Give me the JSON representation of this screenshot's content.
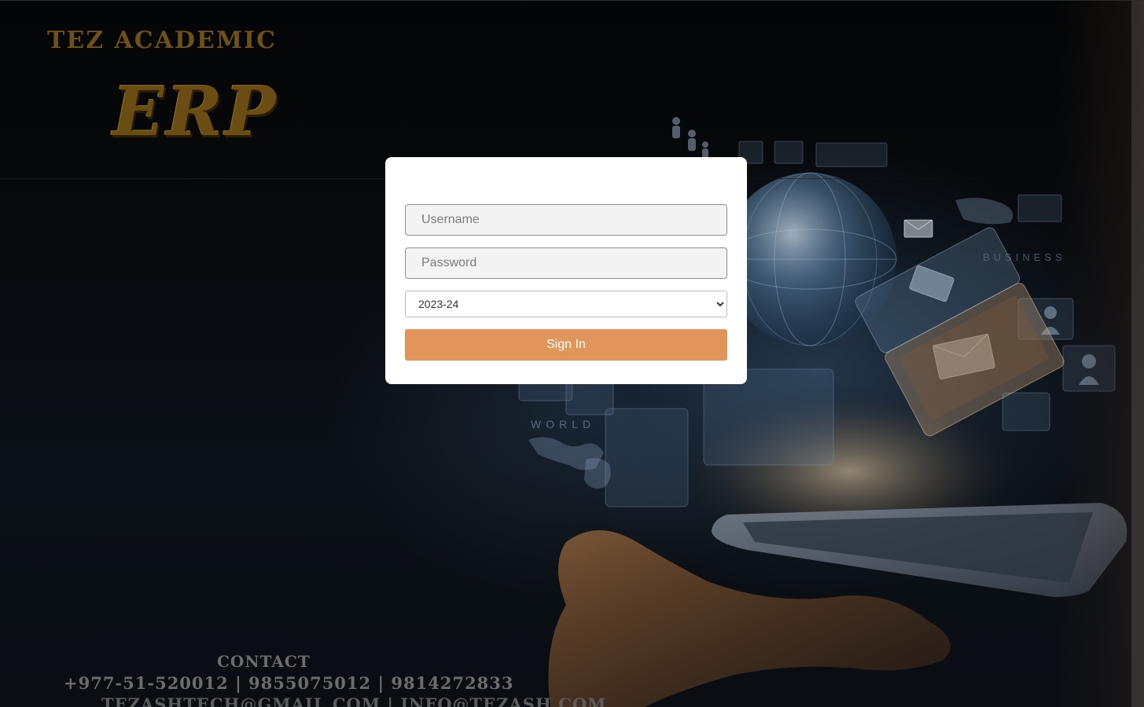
{
  "brand": {
    "line1": "TEZ ACADEMIC",
    "line2": "ERP"
  },
  "login": {
    "username_placeholder": "Username",
    "username_value": "",
    "password_placeholder": "Password",
    "password_value": "",
    "session_selected": "2023-24",
    "sign_in_label": "Sign In",
    "button_color": "#e1955a"
  },
  "background": {
    "labels": {
      "world": "WORLD",
      "business": "BUSINESS"
    }
  },
  "contact": {
    "title": "CONTACT",
    "phones": "+977-51-520012 | 9855075012 | 9814272833",
    "emails": "TEZASHTECH@GMAIL.COM | INFO@TEZASH.COM"
  }
}
